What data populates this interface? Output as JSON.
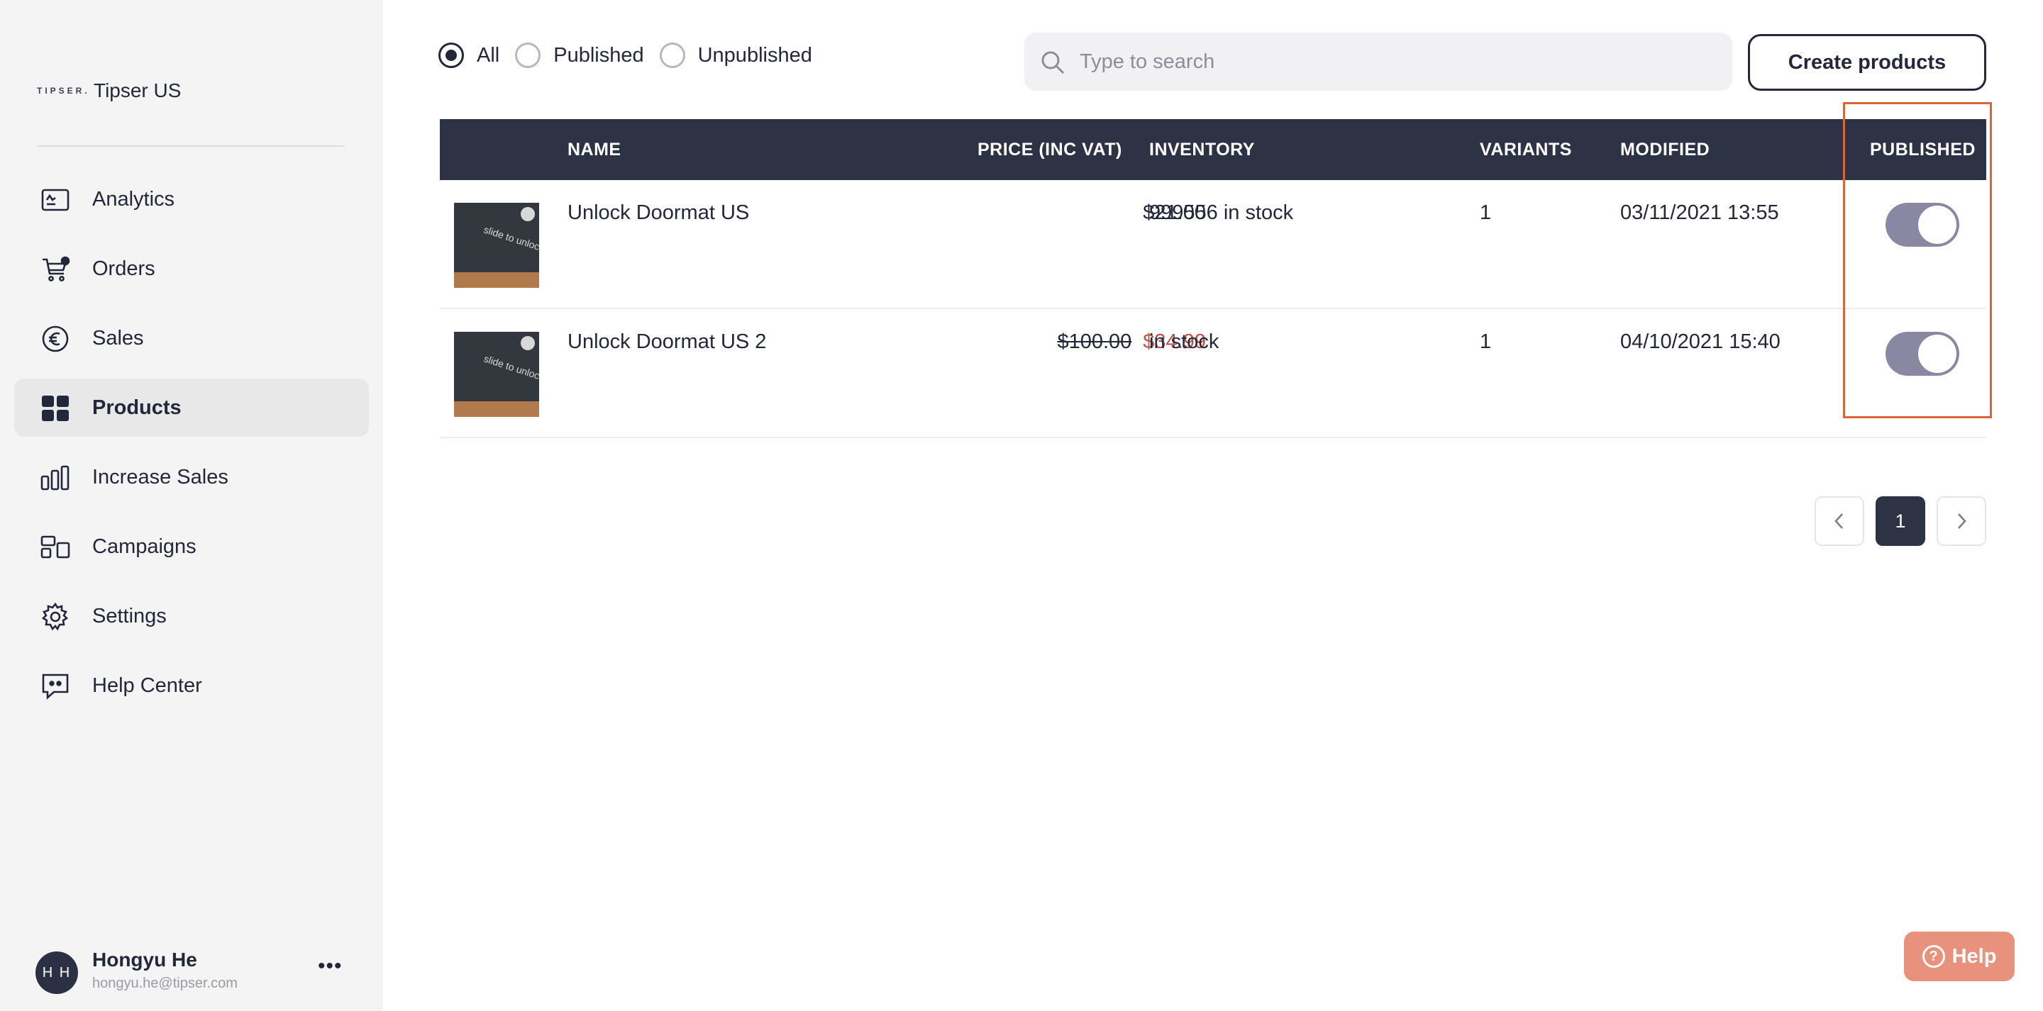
{
  "brand": {
    "logo_text": "TIPSER.",
    "name": "Tipser US"
  },
  "sidebar": {
    "items": [
      {
        "label": "Analytics",
        "icon": "analytics-icon",
        "active": false
      },
      {
        "label": "Orders",
        "icon": "cart-icon",
        "active": false
      },
      {
        "label": "Sales",
        "icon": "euro-icon",
        "active": false
      },
      {
        "label": "Products",
        "icon": "grid-icon",
        "active": true
      },
      {
        "label": "Increase Sales",
        "icon": "bar-chart-icon",
        "active": false
      },
      {
        "label": "Campaigns",
        "icon": "campaigns-icon",
        "active": false
      },
      {
        "label": "Settings",
        "icon": "gear-icon",
        "active": false
      },
      {
        "label": "Help Center",
        "icon": "chat-quote-icon",
        "active": false
      }
    ]
  },
  "user": {
    "initials": "H H",
    "name": "Hongyu He",
    "email": "hongyu.he@tipser.com",
    "more": "•••"
  },
  "filters": {
    "options": [
      "All",
      "Published",
      "Unpublished"
    ],
    "selected": "All"
  },
  "search": {
    "placeholder": "Type to search",
    "value": ""
  },
  "toolbar": {
    "create_label": "Create products"
  },
  "table": {
    "headers": {
      "name": "NAME",
      "price": "PRICE (INC VAT)",
      "inventory": "INVENTORY",
      "variants": "VARIANTS",
      "modified": "MODIFIED",
      "published": "PUBLISHED"
    },
    "rows": [
      {
        "name": "Unlock Doormat US",
        "price": "$21.00",
        "old_price": "",
        "inventory": "999556 in stock",
        "variants": "1",
        "modified": "03/11/2021 13:55",
        "published": true
      },
      {
        "name": "Unlock Doormat US 2",
        "price": "$34.99",
        "old_price": "$100.00",
        "inventory": "in stock",
        "variants": "1",
        "modified": "04/10/2021 15:40",
        "published": true
      }
    ]
  },
  "pagination": {
    "current": "1"
  },
  "help": {
    "label": "Help",
    "icon_text": "?"
  },
  "colors": {
    "header_bg": "#2e3245",
    "sale_price": "#c0504a",
    "toggle_on": "#8a87a3",
    "highlight": "#d8663a",
    "help_bg": "#e8917d"
  }
}
